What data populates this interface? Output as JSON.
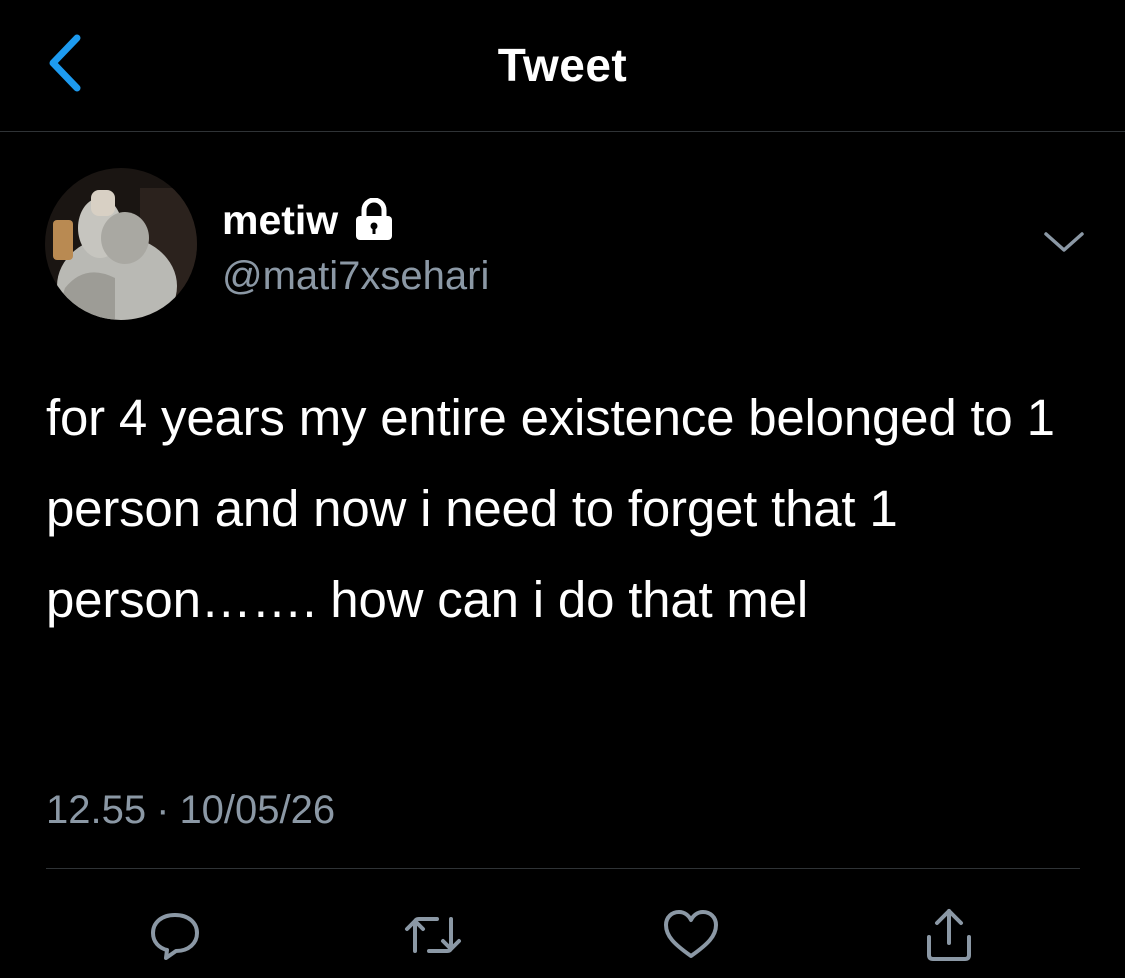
{
  "header": {
    "title": "Tweet",
    "back_icon": "chevron-left-icon"
  },
  "author": {
    "display_name": "metiw",
    "handle": "@mati7xsehari",
    "protected_icon": "lock-icon",
    "avatar_desc": "profile-photo",
    "menu_icon": "chevron-down-icon"
  },
  "tweet": {
    "text": "for 4 years my entire existence belonged to 1 person and now i need to forget that 1 person……. how can i do that mel",
    "time": "12.55",
    "separator": "·",
    "date": "10/05/26"
  },
  "actions": [
    {
      "name": "reply",
      "icon": "reply-icon"
    },
    {
      "name": "retweet",
      "icon": "retweet-icon"
    },
    {
      "name": "like",
      "icon": "heart-icon"
    },
    {
      "name": "share",
      "icon": "share-icon"
    }
  ],
  "colors": {
    "background": "#000000",
    "accent": "#1d9bf0",
    "secondary_text": "#8b98a5",
    "divider": "#2f3336"
  }
}
